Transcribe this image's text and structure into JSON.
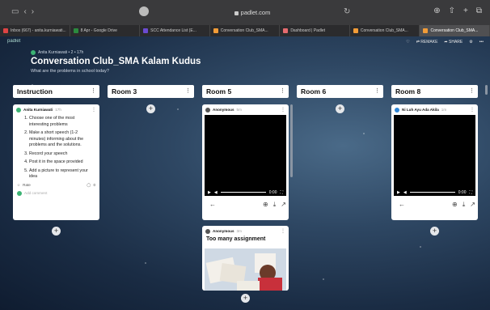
{
  "browser": {
    "url": "padlet.com",
    "tabs": [
      {
        "label": "Inbox (667) - anita.kurniawati...",
        "color": "#d44"
      },
      {
        "label": "8 Apr - Google Drive",
        "color": "#2b8a3e"
      },
      {
        "label": "SCC Attendance List (E...",
        "color": "#6b4bd1"
      },
      {
        "label": "Conversation Club_SMA...",
        "color": "#f29c38"
      },
      {
        "label": "Dashboard | Padlet",
        "color": "#e56b6f"
      },
      {
        "label": "Conversation Club_SMA...",
        "color": "#f29c38"
      },
      {
        "label": "Conversation Club_SMA...",
        "color": "#f29c38"
      }
    ]
  },
  "padlet": {
    "brand": "padlet",
    "author_line": "Anita Kurniawati • 2 • 17h",
    "title": "Conversation Club_SMA Kalam Kudus",
    "subtitle": "What are the problems in school today?",
    "actions": {
      "remake": "REMAKE",
      "share": "SHARE"
    }
  },
  "columns": [
    {
      "title": "Instruction"
    },
    {
      "title": "Room 3"
    },
    {
      "title": "Room 5"
    },
    {
      "title": "Room 6"
    },
    {
      "title": "Room 8"
    }
  ],
  "instruction_card": {
    "author": "Anita Kurniawati",
    "time": "17h",
    "steps": [
      "Choose one of the most interesting problems",
      "Make a short speech (1-2 minutes) informing about the problems and the solutions.",
      "Record your speech",
      "Post it in the space provided",
      "Add a picture to represent your idea"
    ],
    "rate": "Rate",
    "comments": "0",
    "add_comment": "Add comment"
  },
  "room5_cards": [
    {
      "author": "Anonymous",
      "time": "5m",
      "video_time": "0:00"
    },
    {
      "author": "Anonymous",
      "time": "3m",
      "title": "Too many assignment"
    }
  ],
  "room8_card": {
    "author": "Ni Luh Ayu Ada Akila",
    "time": "1m",
    "video_time": "0:00"
  }
}
